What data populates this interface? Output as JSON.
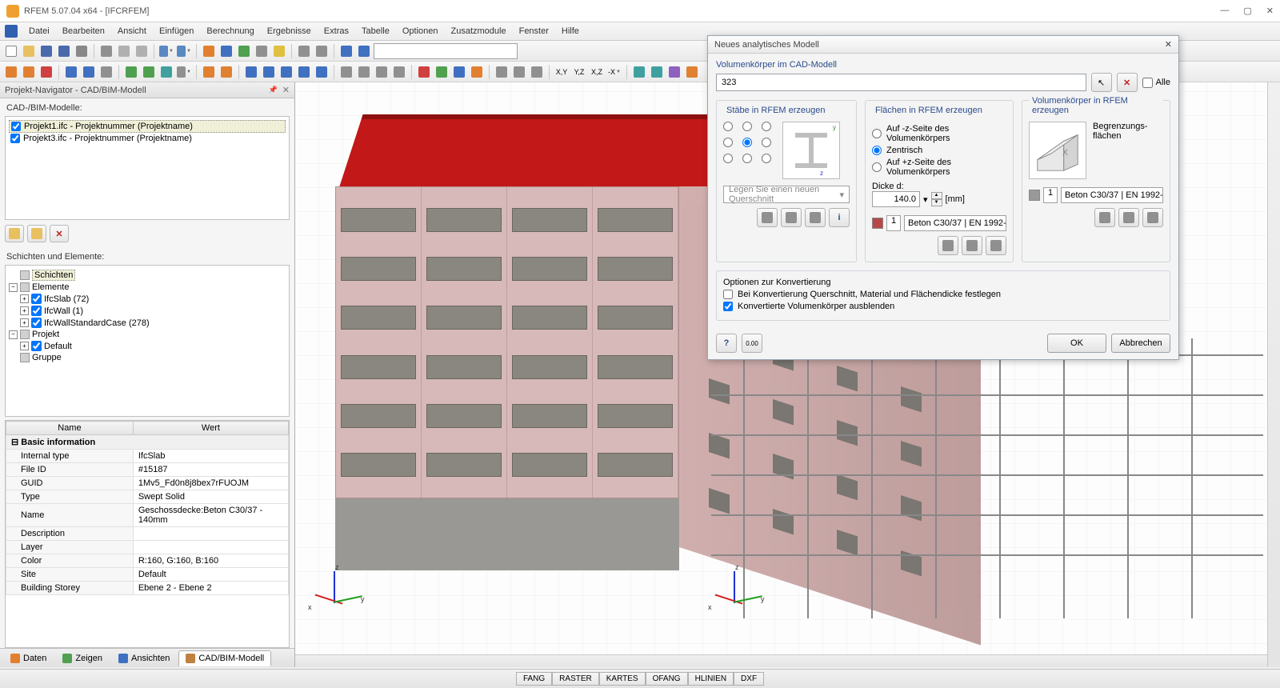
{
  "title": "RFEM 5.07.04 x64 - [IFCRFEM]",
  "menu": [
    "Datei",
    "Bearbeiten",
    "Ansicht",
    "Einfügen",
    "Berechnung",
    "Ergebnisse",
    "Extras",
    "Tabelle",
    "Optionen",
    "Zusatzmodule",
    "Fenster",
    "Hilfe"
  ],
  "navigator": {
    "title": "Projekt-Navigator - CAD/BIM-Modell",
    "models_label": "CAD-/BIM-Modelle:",
    "models": [
      "Projekt1.ifc - Projektnummer (Projektname)",
      "Projekt3.ifc - Projektnummer (Projektname)"
    ],
    "layers_label": "Schichten und Elemente:",
    "tree": {
      "schichten": "Schichten",
      "elemente": "Elemente",
      "ifcSlab": "IfcSlab (72)",
      "ifcWall": "IfcWall (1)",
      "ifcWallStd": "IfcWallStandardCase (278)",
      "projekt": "Projekt",
      "default": "Default",
      "gruppe": "Gruppe"
    },
    "prop_headers": [
      "Name",
      "Wert"
    ],
    "prop_section": "Basic information",
    "props": [
      [
        "Internal type",
        "IfcSlab"
      ],
      [
        "File ID",
        "#15187"
      ],
      [
        "GUID",
        "1Mv5_Fd0n8j8bex7rFUOJM"
      ],
      [
        "Type",
        "Swept Solid"
      ],
      [
        "Name",
        "Geschossdecke:Beton C30/37 - 140mm"
      ],
      [
        "Description",
        ""
      ],
      [
        "Layer",
        ""
      ],
      [
        "Color",
        "R:160, G:160, B:160"
      ],
      [
        "Site",
        "Default"
      ],
      [
        "Building Storey",
        "Ebene 2 - Ebene 2"
      ]
    ],
    "tabs": [
      "Daten",
      "Zeigen",
      "Ansichten",
      "CAD/BIM-Modell"
    ]
  },
  "dialog": {
    "title": "Neues analytisches Modell",
    "sect_volumes": "Volumenkörper im CAD-Modell",
    "input_value": "323",
    "alle": "Alle",
    "g_stabe": "Stäbe in RFEM erzeugen",
    "g_flaechen": "Flächen in RFEM erzeugen",
    "g_volumen": "Volumenkörper in RFEM erzeugen",
    "r_minusZ": "Auf -z-Seite des Volumenkörpers",
    "r_zentrisch": "Zentrisch",
    "r_plusZ": "Auf +z-Seite des Volumenkörpers",
    "dicke_label": "Dicke d:",
    "dicke_value": "140.0",
    "dicke_unit": "[mm]",
    "begrenzung": "Begrenzungs-\nflächen",
    "mat_num": "1",
    "mat_text": "Beton C30/37 | EN 1992-",
    "qs_placeholder": "Legen Sie einen neuen Querschnitt",
    "opt_title": "Optionen zur Konvertierung",
    "opt1": "Bei Konvertierung Querschnitt, Material und Flächendicke festlegen",
    "opt2": "Konvertierte Volumenkörper ausblenden",
    "ok": "OK",
    "cancel": "Abbrechen"
  },
  "statusbar": [
    "FANG",
    "RASTER",
    "KARTES",
    "OFANG",
    "HLINIEN",
    "DXF"
  ],
  "axis_labels": {
    "x": "x",
    "y": "y",
    "z": "z"
  }
}
